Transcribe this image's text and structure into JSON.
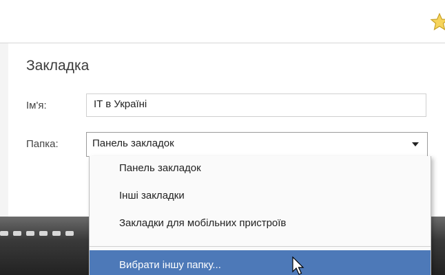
{
  "dialog": {
    "title": "Закладка",
    "name_label": "Ім'я:",
    "name_value": "IT в Україні",
    "folder_label": "Папка:",
    "folder_value": "Панель закладок"
  },
  "dropdown": {
    "options": [
      "Панель закладок",
      "Інші закладки",
      "Закладки для мобільних пристроїв",
      "Вибрати іншу папку..."
    ],
    "highlighted_index": 3,
    "highlight_color": "#4d79b8"
  },
  "icons": {
    "bookmark_star": "star-icon",
    "dropdown_arrow": "chevron-down-icon",
    "mouse_pointer": "cursor-icon"
  }
}
